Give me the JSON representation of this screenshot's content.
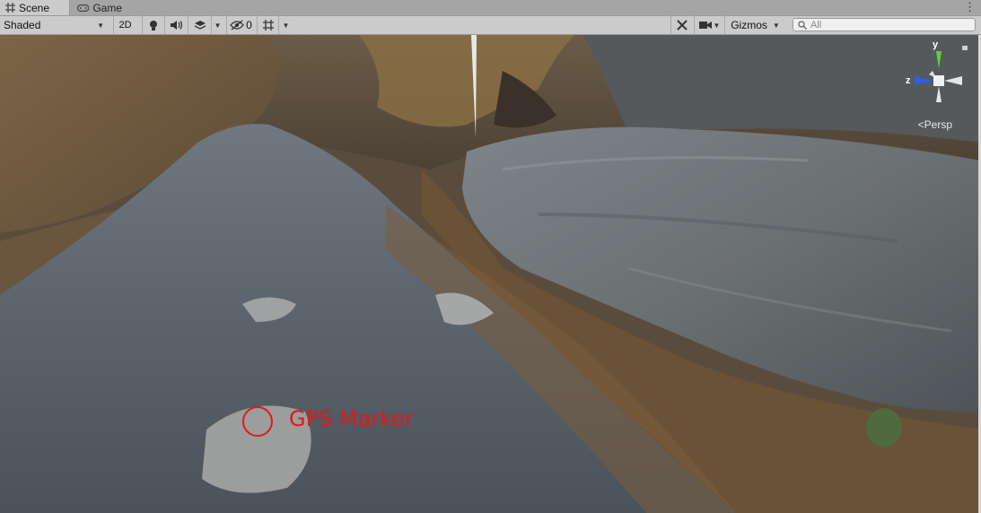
{
  "tabs": [
    {
      "label": "Scene",
      "icon": "grid-icon",
      "active": true
    },
    {
      "label": "Game",
      "icon": "gamepad-icon",
      "active": false
    }
  ],
  "tab_menu_icon": "kebab-menu-icon",
  "toolbar": {
    "shading_mode": "Shaded",
    "mode_2d_label": "2D",
    "hidden_count": "0",
    "gizmos_label": "Gizmos",
    "search_placeholder": "All"
  },
  "scene": {
    "projection_label": "Persp",
    "axis_y": "y",
    "axis_z": "z",
    "annotation_label": "GPS Marker",
    "annotation_color": "#e01a1a"
  },
  "colors": {
    "tab_bar": "#a5a5a5",
    "toolbar": "#cbcbcb",
    "gizmo_y": "#5cd13a",
    "gizmo_z": "#2f5fe0"
  }
}
